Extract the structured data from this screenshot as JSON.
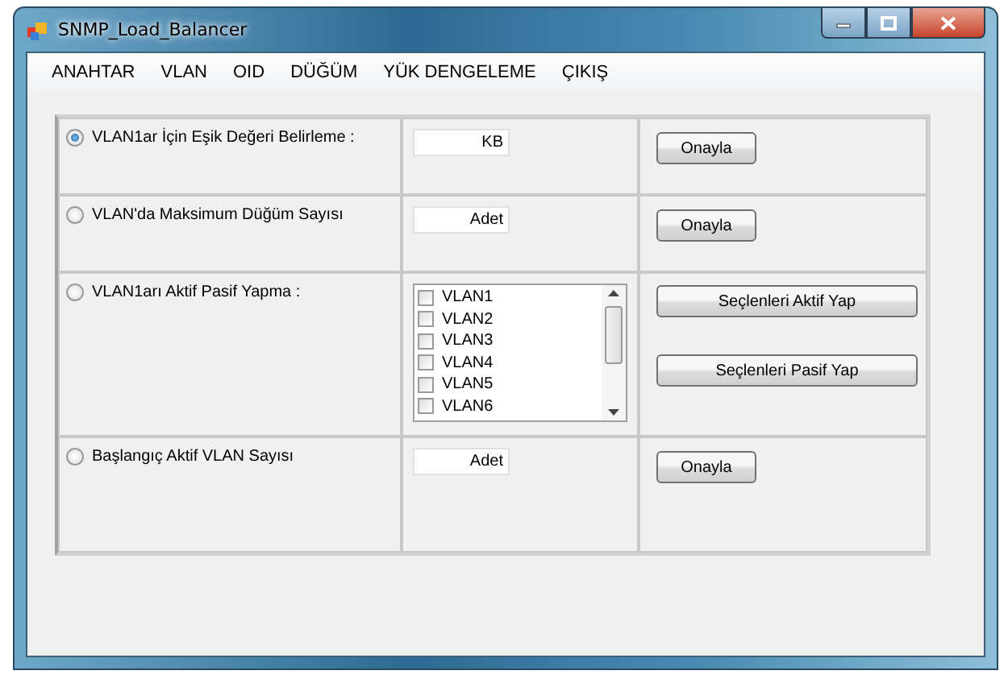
{
  "window": {
    "title": "SNMP_Load_Balancer"
  },
  "menu": [
    "ANAHTAR",
    "VLAN",
    "OID",
    "DÜĞÜM",
    "YÜK DENGELEME",
    "ÇIKIŞ"
  ],
  "rows": [
    {
      "kind": "input",
      "label": "VLAN1ar İçin Eşik Değeri Belirleme :",
      "selected": true,
      "field": {
        "value": "KB"
      },
      "button": "Onayla"
    },
    {
      "kind": "input",
      "label": "VLAN'da Maksimum Düğüm Sayısı",
      "selected": false,
      "field": {
        "value": "Adet"
      },
      "button": "Onayla"
    },
    {
      "kind": "list",
      "label": "VLAN1arı Aktif Pasif Yapma :",
      "selected": false,
      "items": [
        {
          "label": "VLAN1",
          "checked": false
        },
        {
          "label": "VLAN2",
          "checked": false
        },
        {
          "label": "VLAN3",
          "checked": false
        },
        {
          "label": "VLAN4",
          "checked": false
        },
        {
          "label": "VLAN5",
          "checked": false
        },
        {
          "label": "VLAN6",
          "checked": false
        }
      ],
      "buttons": [
        "Seçlenleri Aktif Yap",
        "Seçlenleri Pasif Yap"
      ]
    },
    {
      "kind": "input",
      "label": "Başlangıç Aktif VLAN Sayısı",
      "selected": false,
      "field": {
        "value": "Adet"
      },
      "button": "Onayla"
    }
  ]
}
